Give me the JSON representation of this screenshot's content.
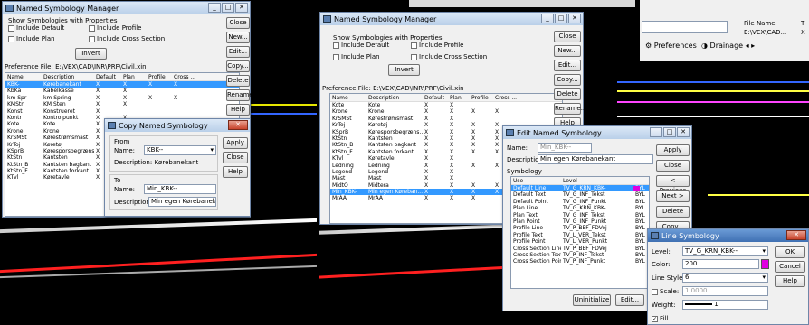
{
  "left": {
    "nsm": {
      "title": "Named Symbology Manager",
      "show_label": "Show Symbologies with Properties",
      "inc_default": "Include Default",
      "inc_profile": "Include Profile",
      "inc_plan": "Include Plan",
      "inc_cross": "Include Cross Section",
      "invert": "Invert",
      "pref_label": "Preference File:",
      "pref_path": "E:\\VEX\\CAD\\INR\\PRF\\Civil.xin",
      "buttons": [
        "Close",
        "New...",
        "Edit...",
        "Copy...",
        "Delete",
        "Rename...",
        "Help"
      ],
      "cols": [
        "Name",
        "Description",
        "Default",
        "Plan",
        "Profile",
        "Cross ..."
      ],
      "rows": [
        [
          "KBK-",
          "Kørebanekant",
          "X",
          "X",
          "X",
          "X"
        ],
        [
          "KbKa",
          "Kabelkasse",
          "X",
          "X",
          "",
          ""
        ],
        [
          "km Spr",
          "km Spring",
          "X",
          "X",
          "X",
          "X"
        ],
        [
          "KMStn",
          "KM Sten",
          "X",
          "X",
          "",
          ""
        ],
        [
          "Konst",
          "Konstrueret",
          "X",
          "",
          "",
          ""
        ],
        [
          "Kontr",
          "Kontrolpunkt",
          "X",
          "X",
          "",
          ""
        ],
        [
          "Kote",
          "Kote",
          "X",
          "X",
          "",
          ""
        ],
        [
          "Krone",
          "Krone",
          "X",
          "X",
          "",
          ""
        ],
        [
          "KrSMSt",
          "Kørestrømsmast",
          "X",
          "X",
          "",
          ""
        ],
        [
          "KrToj",
          "Køretøj",
          "X",
          "",
          "",
          ""
        ],
        [
          "KSprB",
          "Køresporsbegræns...",
          "X",
          "",
          "",
          ""
        ],
        [
          "KtStn",
          "Kantsten",
          "X",
          "",
          "",
          ""
        ],
        [
          "KtStn_B",
          "Kantsten bagkant",
          "X",
          "",
          "",
          ""
        ],
        [
          "KtStn_F",
          "Kantsten forkant",
          "X",
          "",
          "",
          ""
        ],
        [
          "KTvl",
          "Køretavle",
          "X",
          "",
          "",
          ""
        ]
      ]
    },
    "copy": {
      "title": "Copy Named Symbology",
      "from": "From",
      "name_label": "Name:",
      "from_name": "KBK--",
      "desc_label": "Description:",
      "from_desc": "Kørebanekant",
      "to": "To",
      "to_name": "Min_KBK--",
      "to_desc": "Min egen Kørebanekant",
      "buttons": [
        "Apply",
        "Close",
        "Help"
      ]
    }
  },
  "right": {
    "nsm": {
      "title": "Named Symbology Manager",
      "show_label": "Show Symbologies with Properties",
      "inc_default": "Include Default",
      "inc_profile": "Include Profile",
      "inc_plan": "Include Plan",
      "inc_cross": "Include Cross Section",
      "invert": "Invert",
      "pref_label": "Preference File:",
      "pref_path": "E:\\VEX\\CAD\\INR\\PRF\\Civil.xin",
      "buttons": [
        "Close",
        "New...",
        "Edit...",
        "Copy...",
        "Delete",
        "Rename...",
        "Help"
      ],
      "cols": [
        "Name",
        "Description",
        "Default",
        "Plan",
        "Profile",
        "Cross ..."
      ],
      "rows": [
        [
          "Kote",
          "Kote",
          "X",
          "X",
          "",
          ""
        ],
        [
          "Krone",
          "Krone",
          "X",
          "X",
          "X",
          "X"
        ],
        [
          "KrSMSt",
          "Kørestrømsmast",
          "X",
          "X",
          "",
          ""
        ],
        [
          "KrToj",
          "Køretøj",
          "X",
          "X",
          "X",
          "X"
        ],
        [
          "KSprB",
          "Køresporsbegræns...",
          "X",
          "X",
          "X",
          "X"
        ],
        [
          "KtStn",
          "Kantsten",
          "X",
          "X",
          "X",
          "X"
        ],
        [
          "KtStn_B",
          "Kantsten bagkant",
          "X",
          "X",
          "X",
          "X"
        ],
        [
          "KtStn_F",
          "Kantsten forkant",
          "X",
          "X",
          "X",
          "X"
        ],
        [
          "KTvl",
          "Køretavle",
          "X",
          "X",
          "",
          ""
        ],
        [
          "Ledning",
          "Ledning",
          "X",
          "X",
          "X",
          "X"
        ],
        [
          "Legend",
          "Legend",
          "X",
          "X",
          "",
          ""
        ],
        [
          "Mast",
          "Mast",
          "X",
          "X",
          "",
          ""
        ],
        [
          "MidtO",
          "Midtera",
          "X",
          "X",
          "X",
          "X"
        ],
        [
          "Min_KBK-",
          "Min egen Køreban...",
          "X",
          "X",
          "X",
          "X"
        ],
        [
          "MrAA",
          "MrAA",
          "X",
          "X",
          "X",
          ""
        ]
      ]
    },
    "edit": {
      "title": "Edit Named Symbology",
      "name_label": "Name:",
      "name": "Min_KBK--",
      "desc_label": "Description:",
      "desc": "Min egen Kørebanekant",
      "symbology": "Symbology",
      "cols": [
        "Use",
        "Level"
      ],
      "rows": [
        [
          "Default Line",
          "TV_G_KRN_KBK-",
          "BYL"
        ],
        [
          "Default Text",
          "TV_G_INF_Tekst",
          "BYL"
        ],
        [
          "Default Point",
          "TV_G_INF_Punkt",
          "BYL"
        ],
        [
          "Plan Line",
          "TV_G_KRN_KBK-",
          "BYL"
        ],
        [
          "Plan Text",
          "TV_G_INF_Tekst",
          "BYL"
        ],
        [
          "Plan Point",
          "TV_G_INF_Punkt",
          "BYL"
        ],
        [
          "Profile Line",
          "TV_P_BEF_FDVej",
          "BYL"
        ],
        [
          "Profile Text",
          "TV_L_VER_Tekst",
          "BYL"
        ],
        [
          "Profile Point",
          "TV_L_VER_Punkt",
          "BYL"
        ],
        [
          "Cross Section Line",
          "TV_P_BEF_FDVej",
          "BYL"
        ],
        [
          "Cross Section Text",
          "TV_P_INF_Tekst",
          "BYL"
        ],
        [
          "Cross Section Point",
          "TV_P_INF_Punkt",
          "BYL"
        ]
      ],
      "buttons": [
        "Apply",
        "Close",
        "< Previous",
        "Next >",
        "Delete",
        "Copy...",
        "Help"
      ],
      "uninit": "Uninitialize",
      "edit_btn": "Edit..."
    },
    "line": {
      "title": "Line Symbology",
      "level_label": "Level:",
      "level": "TV_G_KRN_KBK--",
      "color_label": "Color:",
      "color": "200",
      "style_label": "Line Style:",
      "style": "6",
      "scale_label": "Scale:",
      "scale": "1.0000",
      "weight_label": "Weight:",
      "weight": "1",
      "fill_label": "Fill",
      "buttons": [
        "OK",
        "Cancel",
        "Help"
      ]
    },
    "prefs": {
      "file_name": "File Name",
      "file_path": "E:\\VEX\\CAD...",
      "preferences": "Preferences",
      "drainage": "Drainage",
      "tab_t": "T",
      "tab_x": "X"
    }
  },
  "colors": {
    "magenta": "#e000e0",
    "select": "#3399ff"
  }
}
